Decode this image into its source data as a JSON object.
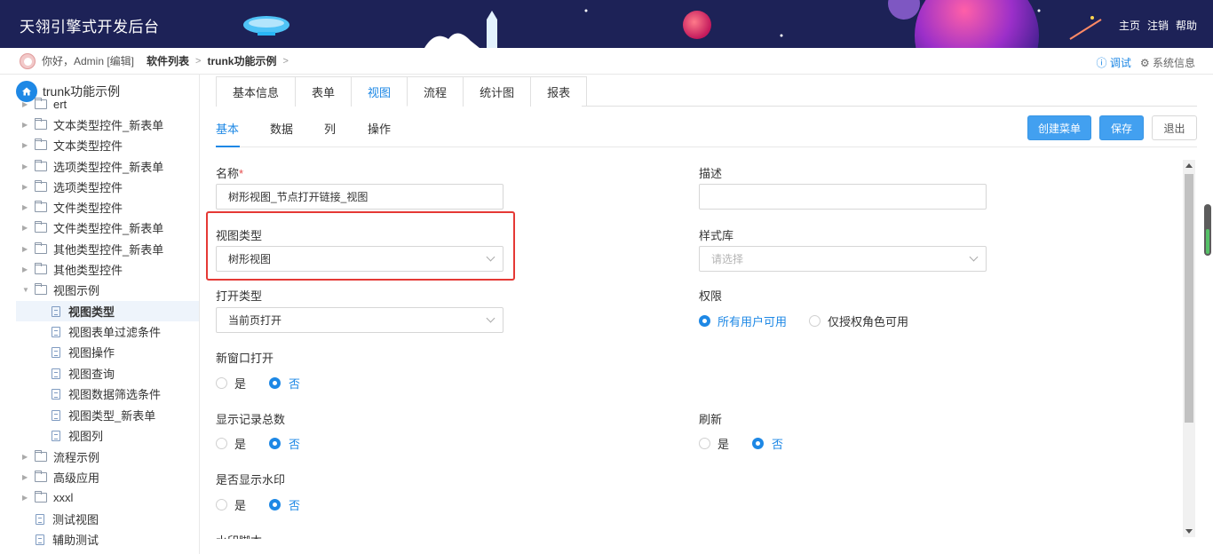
{
  "header": {
    "title": "天翎引擎式开发后台",
    "links": [
      "主页",
      "注销",
      "帮助"
    ]
  },
  "crumbbar": {
    "greeting": "你好，Admin [编辑]",
    "crumbs": [
      "软件列表",
      "trunk功能示例"
    ],
    "debug": "调试",
    "sysinfo": "系统信息"
  },
  "sidebar": {
    "root": "trunk功能示例",
    "items": [
      {
        "label": "ert",
        "type": "folder"
      },
      {
        "label": "文本类型控件_新表单",
        "type": "folder"
      },
      {
        "label": "文本类型控件",
        "type": "folder"
      },
      {
        "label": "选项类型控件_新表单",
        "type": "folder"
      },
      {
        "label": "选项类型控件",
        "type": "folder"
      },
      {
        "label": "文件类型控件",
        "type": "folder"
      },
      {
        "label": "文件类型控件_新表单",
        "type": "folder"
      },
      {
        "label": "其他类型控件_新表单",
        "type": "folder"
      },
      {
        "label": "其他类型控件",
        "type": "folder"
      },
      {
        "label": "视图示例",
        "type": "folder-open"
      },
      {
        "label": "视图类型",
        "type": "child",
        "selected": true
      },
      {
        "label": "视图表单过滤条件",
        "type": "child"
      },
      {
        "label": "视图操作",
        "type": "child"
      },
      {
        "label": "视图查询",
        "type": "child"
      },
      {
        "label": "视图数据筛选条件",
        "type": "child"
      },
      {
        "label": "视图类型_新表单",
        "type": "child"
      },
      {
        "label": "视图列",
        "type": "child"
      },
      {
        "label": "流程示例",
        "type": "folder"
      },
      {
        "label": "高级应用",
        "type": "folder"
      },
      {
        "label": "xxxl",
        "type": "folder"
      },
      {
        "label": "测试视图",
        "type": "file"
      },
      {
        "label": "辅助测试",
        "type": "file"
      }
    ]
  },
  "tabs": [
    "基本信息",
    "表单",
    "视图",
    "流程",
    "统计图",
    "报表"
  ],
  "subtabs": [
    "基本",
    "数据",
    "列",
    "操作"
  ],
  "buttons": {
    "create_menu": "创建菜单",
    "save": "保存",
    "exit": "退出"
  },
  "form": {
    "name_label": "名称",
    "name_required": "*",
    "name_value": "树形视图_节点打开链接_视图",
    "desc_label": "描述",
    "desc_value": "",
    "view_type_label": "视图类型",
    "view_type_value": "树形视图",
    "style_label": "样式库",
    "style_placeholder": "请选择",
    "open_type_label": "打开类型",
    "open_type_value": "当前页打开",
    "permission_label": "权限",
    "permission_options": [
      "所有用户可用",
      "仅授权角色可用"
    ],
    "new_window_label": "新窗口打开",
    "show_total_label": "显示记录总数",
    "refresh_label": "刷新",
    "watermark_label": "是否显示水印",
    "yes": "是",
    "no": "否",
    "watermark_script_label": "水印脚本"
  },
  "colors": {
    "header_bg": "#1d2257",
    "accent": "#1e88e5",
    "highlight": "#e53935"
  }
}
